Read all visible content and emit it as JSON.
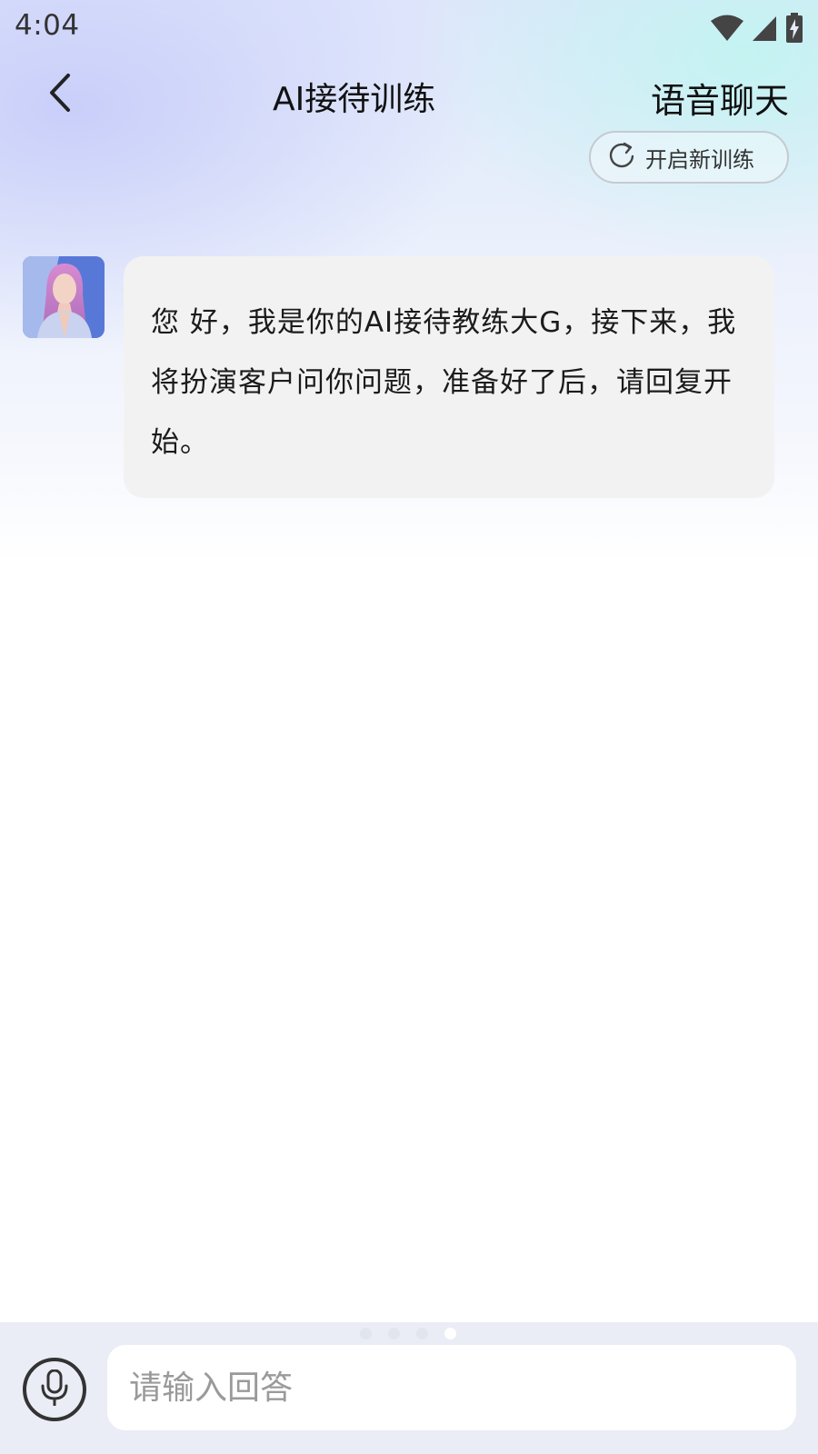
{
  "status_bar": {
    "time": "4:04",
    "icons": [
      "wifi-icon",
      "cellular-signal-icon",
      "battery-charging-icon"
    ]
  },
  "header": {
    "back_icon": "chevron-left-icon",
    "title": "AI接待训练",
    "voice_chat_label": "语音聊天"
  },
  "new_training_button": {
    "icon": "refresh-icon",
    "label": "开启新训练"
  },
  "messages": [
    {
      "sender": "ai",
      "avatar": "avatar",
      "text": "您 好，我是你的AI接待教练大G，接下来，我将扮演客户问你问题，准备好了后，请回复开始。"
    }
  ],
  "pager": {
    "total": 4,
    "active_index": 3
  },
  "input": {
    "mic_icon": "microphone-icon",
    "placeholder": "请输入回答",
    "value": ""
  },
  "colors": {
    "bubble_background": "#f2f2f2",
    "bottom_bar": "#eaedf5",
    "text": "#111111"
  }
}
